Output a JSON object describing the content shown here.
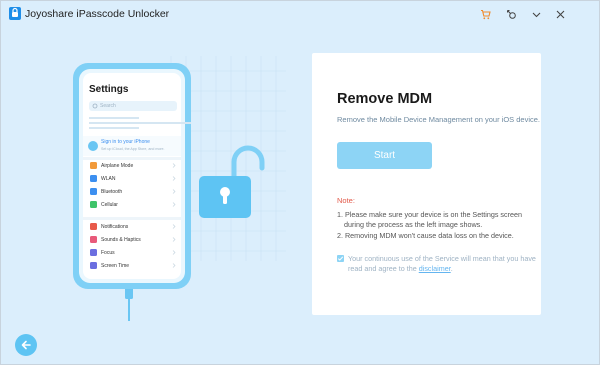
{
  "app": {
    "title": "Joyoshare iPasscode Unlocker"
  },
  "titlebar": {
    "icons": [
      "cart-icon",
      "register-icon",
      "dropdown-icon",
      "close-icon"
    ]
  },
  "phone": {
    "header": "Settings",
    "search_placeholder": "Search",
    "account_line1": "Sign in to your iPhone",
    "account_line2": "Set up iCloud, the App Store, and more.",
    "group1": [
      "Airplane Mode",
      "WLAN",
      "Bluetooth",
      "Cellular"
    ],
    "group2": [
      "Notifications",
      "Sounds & Haptics",
      "Focus",
      "Screen Time"
    ]
  },
  "panel": {
    "title": "Remove MDM",
    "subtitle": "Remove the Mobile Device Management on your iOS device.",
    "start_label": "Start",
    "note_title": "Note:",
    "note1_line1": "1. Please make sure your device is on the Settings screen",
    "note1_line2": "during the process as the left image shows.",
    "note2": "2. Removing MDM won't cause data loss on the device.",
    "agree_text": "Your continuous use of the Service will mean that you have read and agree to the",
    "agree_link": "disclaimer",
    "agree_end": "."
  },
  "colors": {
    "accent": "#5ec4f3",
    "button": "#8dd4f5",
    "background": "#dbeefc",
    "note": "#e25a4a"
  }
}
